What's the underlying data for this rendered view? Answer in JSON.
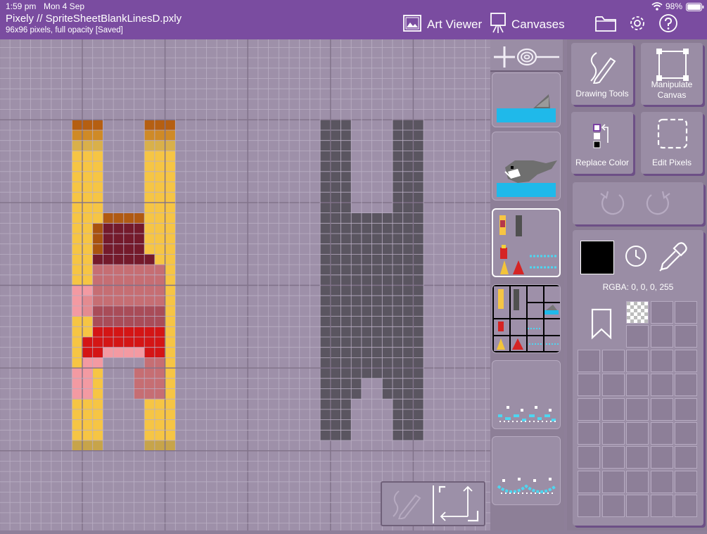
{
  "status_bar": {
    "time": "1:59 pm",
    "date": "Mon 4 Sep",
    "battery": "98%"
  },
  "title_bar": {
    "title": "Pixely // SpriteSheetBlankLinesD.pxly",
    "subtitle": "96x96 pixels, full opacity [Saved]",
    "art_viewer": "Art Viewer",
    "canvases": "Canvases"
  },
  "tools": {
    "drawing": "Drawing Tools",
    "manipulate_line1": "Manipulate",
    "manipulate_line2": "Canvas",
    "replace_color": "Replace Color",
    "edit_pixels": "Edit Pixels"
  },
  "color": {
    "current": "#000000",
    "rgba_label": "RGBA: 0, 0, 0, 255"
  },
  "colors": {
    "topbar": "#7a4ca0",
    "canvas_bg": "#9e90a9",
    "grid_line": "#b9aec3",
    "block_line": "#807289"
  },
  "icons": [
    "art-viewer-icon",
    "easel-icon",
    "folder-icon",
    "gear-icon",
    "help-icon",
    "wifi-icon",
    "battery-icon",
    "pen-icon",
    "manipulate-icon",
    "replace-color-icon",
    "edit-pixels-icon",
    "undo-icon",
    "redo-icon",
    "clock-icon",
    "eyedropper-icon",
    "bookmark-icon",
    "transparent-swatch-icon",
    "add-icon",
    "spiral-icon"
  ]
}
